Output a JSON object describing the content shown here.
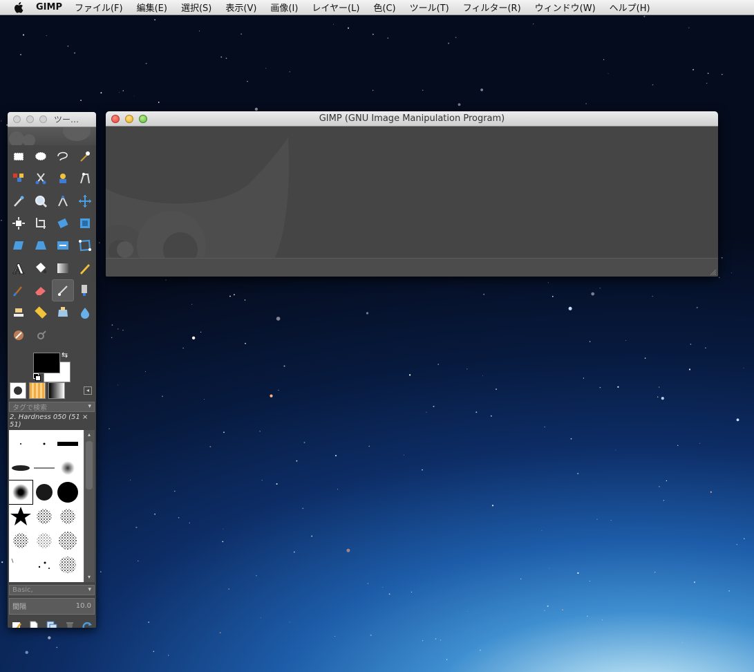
{
  "menubar": {
    "app_name": "GIMP",
    "items": [
      "ファイル(F)",
      "編集(E)",
      "選択(S)",
      "表示(V)",
      "画像(I)",
      "レイヤー(L)",
      "色(C)",
      "ツール(T)",
      "フィルター(R)",
      "ウィンドウ(W)",
      "ヘルプ(H)"
    ]
  },
  "main_window": {
    "title": "GIMP (GNU Image Manipulation Program)"
  },
  "toolbox": {
    "title": "ツー…",
    "tools": [
      "rect-select",
      "ellipse-select",
      "free-select",
      "fuzzy-select",
      "select-by-color",
      "scissors-select",
      "foreground-select",
      "paths",
      "color-picker",
      "zoom",
      "measure",
      "move",
      "align",
      "crop",
      "rotate",
      "scale",
      "shear",
      "perspective",
      "flip",
      "cage-transform",
      "text",
      "bucket-fill",
      "blend",
      "pencil",
      "paintbrush",
      "eraser",
      "airbrush",
      "ink",
      "clone",
      "heal",
      "perspective-clone",
      "blur",
      "smudge",
      "dodge-burn"
    ],
    "active_tool": "airbrush",
    "foreground_color": "#000000",
    "background_color": "#ffffff",
    "tag_search_placeholder": "タグで検索",
    "brush_name": "2. Hardness 050 (51 × 51)",
    "preset_combo": "Basic,",
    "spacing_label": "間隔",
    "spacing_value": "10.0"
  }
}
